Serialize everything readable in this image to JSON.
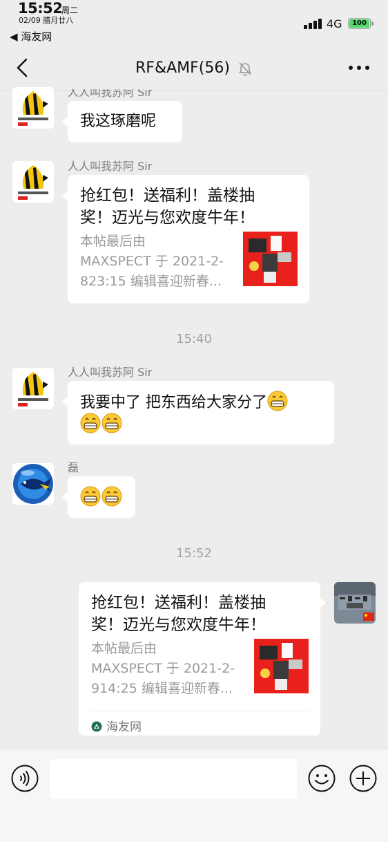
{
  "status_bar": {
    "time": "15:52",
    "weekday": "周二",
    "lunar_date": "02/09 腊月廿八",
    "back_app": "◀ 海友网",
    "network": "4G",
    "battery": "100"
  },
  "nav": {
    "title": "RF&AMF(56)",
    "muted": true
  },
  "messages": [
    {
      "sender": "人人叫我苏阿 Sir",
      "text": "我这琢磨呢"
    },
    {
      "sender": "人人叫我苏阿 Sir",
      "card_title": "抢红包！送福利！盖楼抽奖！迈光与您欢度牛年！",
      "card_desc": "本帖最后由 MAXSPECT 于 2021-2-823:15 编辑喜迎新春..."
    },
    {
      "time": "15:40"
    },
    {
      "sender": "人人叫我苏阿 Sir",
      "text": "我要中了 把东西给大家分了",
      "emoji": "grin-emoji"
    },
    {
      "sender": "磊",
      "emoji": "grin-emoji"
    },
    {
      "time": "15:52"
    },
    {
      "own": true,
      "card_title": "抢红包！送福利！盖楼抽奖！迈光与您欢度牛年！",
      "card_desc": "本帖最后由 MAXSPECT 于 2021-2-914:25 编辑喜迎新春...",
      "card_source": "海友网"
    }
  ],
  "card_lines": {
    "title_line1": "抢红包！送福利！盖楼抽",
    "title_line2": "奖！迈光与您欢度牛年！",
    "desc1_line1": "本帖最后由",
    "desc1_line2": "MAXSPECT 于 2021-2-",
    "desc1_line3": "823:15 编辑喜迎新春...",
    "desc2_line1": "本帖最后由",
    "desc2_line2": "MAXSPECT 于 2021-2-",
    "desc2_line3": "914:25 编辑喜迎新春...",
    "msg4_line1": "我要中了 把东西给大家分了"
  },
  "colors": {
    "background": "#ededed",
    "bubble": "#ffffff",
    "battery": "#4cd964",
    "thumb_red": "#e8211d"
  }
}
